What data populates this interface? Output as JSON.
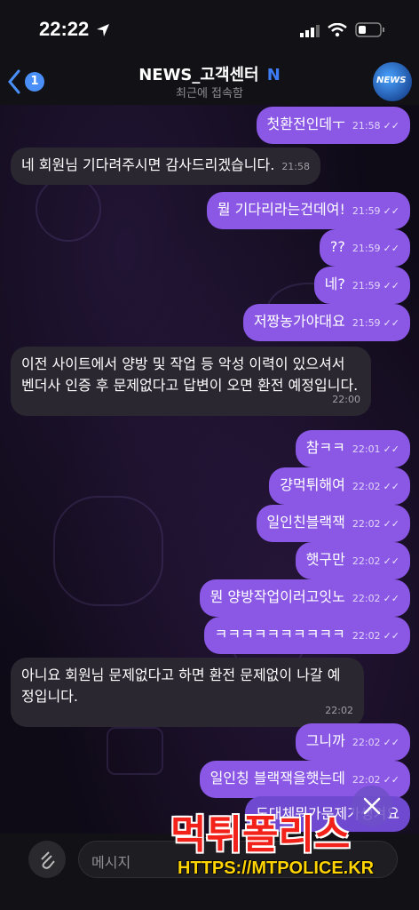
{
  "status": {
    "time": "22:22"
  },
  "nav": {
    "back_count": "1",
    "title": "NEWS_고객센터",
    "title_badge": "N",
    "subtitle": "최근에 접속함",
    "avatar_text": "NEWS"
  },
  "messages": [
    {
      "side": "out",
      "text": "첫환전인데ㅜ",
      "time": "21:58"
    },
    {
      "side": "in",
      "text": "네 회원님 기다려주시면 감사드리겠습니다.",
      "time": "21:58"
    },
    {
      "side": "out",
      "text": "뭘 기다리라는건데여!",
      "time": "21:59"
    },
    {
      "side": "out",
      "text": "??",
      "time": "21:59"
    },
    {
      "side": "out",
      "text": "네?",
      "time": "21:59"
    },
    {
      "side": "out",
      "text": "저짱농가야대요",
      "time": "21:59"
    },
    {
      "side": "in",
      "text": "이전 사이트에서 양방 및 작업 등 악성 이력이 있으셔서 벤더사 인증 후 문제없다고 답변이 오면 환전 예정입니다.",
      "time": "22:00"
    },
    {
      "side": "out",
      "text": "참ㅋㅋ",
      "time": "22:01"
    },
    {
      "side": "out",
      "text": "걍먹튀해여",
      "time": "22:02"
    },
    {
      "side": "out",
      "text": "일인친블랙잭",
      "time": "22:02"
    },
    {
      "side": "out",
      "text": "햇구만",
      "time": "22:02"
    },
    {
      "side": "out",
      "text": "뭔 양방작업이러고잇노",
      "time": "22:02"
    },
    {
      "side": "out",
      "text": "ㅋㅋㅋㅋㅋㅋㅋㅋㅋㅋ",
      "time": "22:02"
    },
    {
      "side": "in",
      "text": "아니요 회원님 문제없다고 하면 환전 문제없이 나갈 예정입니다.",
      "time": "22:02"
    },
    {
      "side": "out",
      "text": "그니까",
      "time": "22:02"
    },
    {
      "side": "out",
      "text": "일인칭 블랙잭을햇는데",
      "time": "22:02"
    },
    {
      "side": "out",
      "text": "도대체뭐가문제가생겨요",
      "time": ""
    }
  ],
  "input": {
    "placeholder": "메시지"
  },
  "watermark": {
    "brand": "먹튀폴리스",
    "url": "HTTPS://MTPOLICE.KR"
  }
}
